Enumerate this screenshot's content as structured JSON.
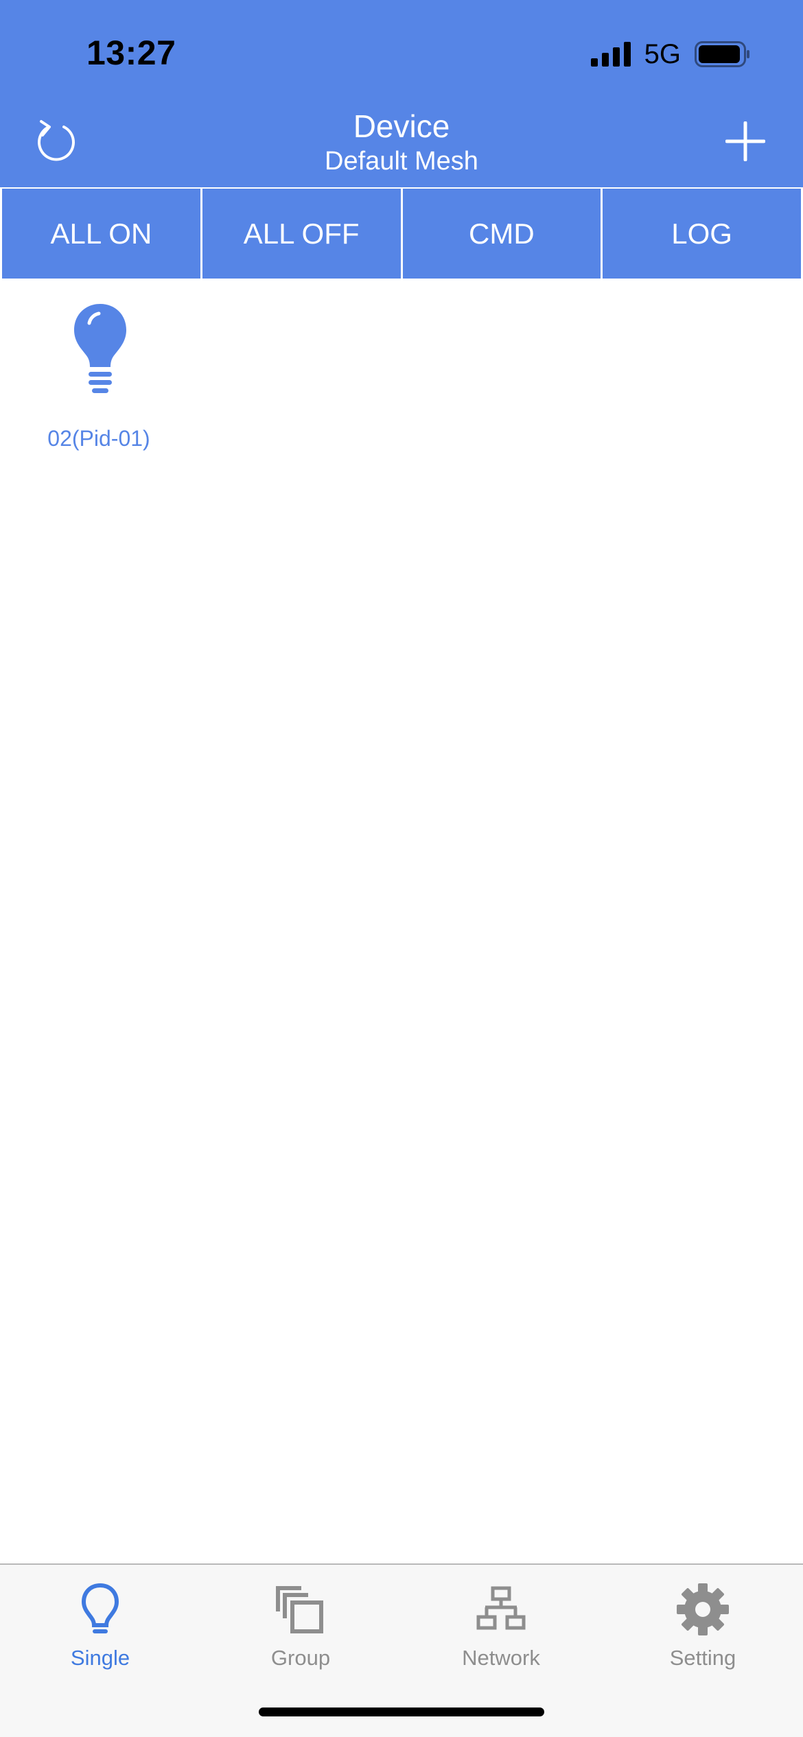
{
  "status_bar": {
    "time": "13:27",
    "network": "5G"
  },
  "nav": {
    "title": "Device",
    "subtitle": "Default Mesh",
    "left_icon": "refresh-icon",
    "right_icon": "plus-icon"
  },
  "actions": [
    {
      "label": "ALL ON"
    },
    {
      "label": "ALL OFF"
    },
    {
      "label": "CMD"
    },
    {
      "label": "LOG"
    }
  ],
  "devices": [
    {
      "label": "02(Pid-01)",
      "icon": "lightbulb-icon"
    }
  ],
  "tabs": [
    {
      "label": "Single",
      "icon": "lightbulb-icon",
      "active": true
    },
    {
      "label": "Group",
      "icon": "group-icon",
      "active": false
    },
    {
      "label": "Network",
      "icon": "network-icon",
      "active": false
    },
    {
      "label": "Setting",
      "icon": "gear-icon",
      "active": false
    }
  ],
  "colors": {
    "primary": "#5685E6",
    "tab_active": "#3F7AE0",
    "tab_inactive": "#8E8E8E",
    "tabbar_bg": "#F7F7F7"
  }
}
